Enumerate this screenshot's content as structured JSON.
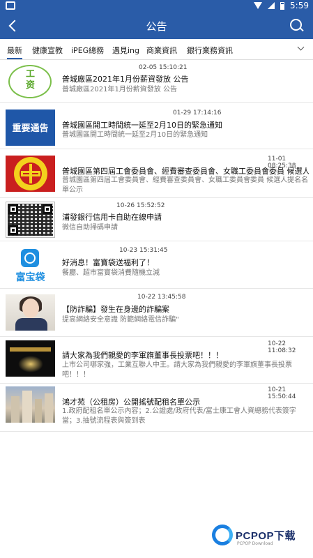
{
  "status_bar": {
    "time": "5:59"
  },
  "header": {
    "title": "公告"
  },
  "tabs": [
    {
      "label": "最新",
      "active": true
    },
    {
      "label": "健康宣教"
    },
    {
      "label": "iPEG總務"
    },
    {
      "label": "遇見ing"
    },
    {
      "label": "商業資訊"
    },
    {
      "label": "銀行業務資訊"
    }
  ],
  "notices": [
    {
      "time": "02-05 15:10:21",
      "title": "普城廠區2021年1月份薪資發放 公告",
      "summary": "普城廠區2021年1月份薪資發放 公告",
      "thumb_text": "工\n资"
    },
    {
      "time": "01-29 17:14:16",
      "title": "普城園區開工時間統一延至2月10日的緊急通知",
      "summary": "普城園區開工時間統一延至2月10日的緊急通知",
      "thumb_text": "重要通告"
    },
    {
      "time": "11-01 08:25:38",
      "title": "普城園區第四屆工會委員會、經費審查委員會、女職工委員會委員 候選人提...",
      "summary": "普城園區第四屆工會委員會、經費審查委員會、女職工委員會委員 候選人提名名單公示"
    },
    {
      "time": "10-26 15:52:52",
      "title": "浦發銀行信用卡自助在線申請",
      "summary": "微信自助掃碼申請"
    },
    {
      "time": "10-23 15:31:45",
      "title": "好消息！富寶袋送福利了！",
      "summary": "餐廳、超市富寶袋消費隨機立減",
      "thumb_text": "富宝袋"
    },
    {
      "time": "10-22 13:45:58",
      "title": "【防詐騙】發生在身邊的詐騙案",
      "summary": "提高網絡安全意識 防範網絡電信詐騙\""
    },
    {
      "time": "10-22 11:08:32",
      "title": "請大家為我們親愛的李軍旗董事長投票吧！！！",
      "summary": "上市公司哪家強，工業互聯人中王。請大家為我們親愛的李軍旗董事長投票吧！！！"
    },
    {
      "time": "10-21 15:50:44",
      "title": "鴻才苑（公租房）公開搖號配租名單公示",
      "summary": "1.政府配租名單公示內容；2.公證處/政府代表/富士康工會人資總務代表簽字當；3.抽號流程表與簽到表"
    }
  ],
  "watermark": {
    "brand": "PCPOP下载",
    "tagline": "PCPOP Download"
  }
}
